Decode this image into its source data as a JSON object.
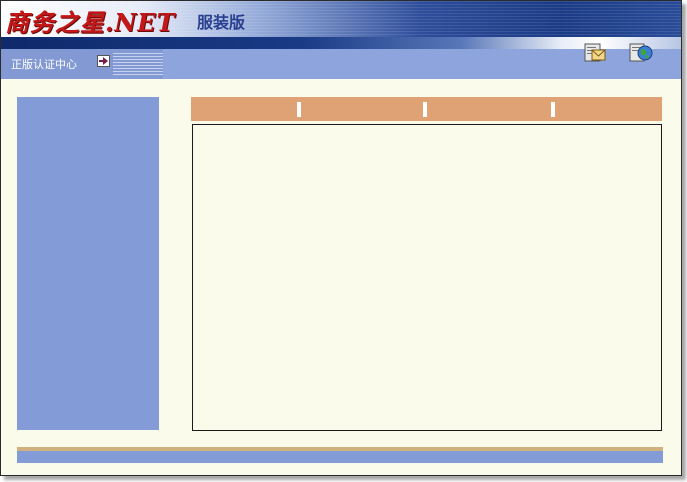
{
  "header": {
    "logo_text": "商务之星.NET",
    "edition": "服装版"
  },
  "toolbar": {
    "auth_link_label": "正版认证中心",
    "icons": [
      "arrow-right-icon",
      "mail-icon",
      "globe-icon"
    ]
  },
  "tabs": {
    "separators": 3
  },
  "colors": {
    "background": "#fbfbeb",
    "sidebar": "#839bd6",
    "tabbar": "#dea274",
    "banner_dark": "#1c3b86",
    "logo": "#c41818"
  }
}
